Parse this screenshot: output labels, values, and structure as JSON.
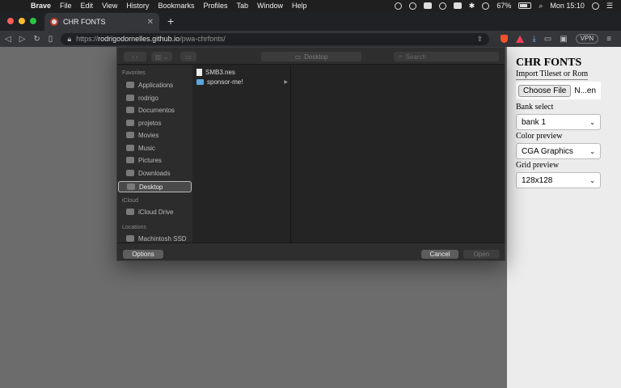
{
  "menubar": {
    "app": "Brave",
    "items": [
      "File",
      "Edit",
      "View",
      "History",
      "Bookmarks",
      "Profiles",
      "Tab",
      "Window",
      "Help"
    ],
    "battery": "67%",
    "clock": "Mon 15:10"
  },
  "tab": {
    "title": "CHR FONTS",
    "close": "✕"
  },
  "toolbar": {
    "url_proto": "https://",
    "url_host": "rodrigodornelles.github.io",
    "url_path": "/pwa-chrfonts/",
    "vpn": "VPN"
  },
  "dialog": {
    "location": "Desktop",
    "search_placeholder": "Search",
    "sidebar": {
      "favorites_header": "Favorites",
      "favorites": [
        {
          "label": "Applications",
          "icon": "applications-icon"
        },
        {
          "label": "rodrigo",
          "icon": "home-icon"
        },
        {
          "label": "Documentos",
          "icon": "document-icon"
        },
        {
          "label": "projetos",
          "icon": "folder-icon"
        },
        {
          "label": "Movies",
          "icon": "film-icon"
        },
        {
          "label": "Music",
          "icon": "music-icon"
        },
        {
          "label": "Pictures",
          "icon": "picture-icon"
        },
        {
          "label": "Downloads",
          "icon": "download-icon"
        },
        {
          "label": "Desktop",
          "icon": "desktop-icon"
        }
      ],
      "icloud_header": "iCloud",
      "icloud": [
        {
          "label": "iCloud Drive",
          "icon": "cloud-icon"
        }
      ],
      "locations_header": "Locations",
      "locations": [
        {
          "label": "Machintosh SSD",
          "icon": "disk-icon"
        }
      ]
    },
    "files": [
      {
        "name": "SMB3.nes",
        "type": "file"
      },
      {
        "name": "sponsor-me!",
        "type": "folder"
      }
    ],
    "options_label": "Options",
    "cancel_label": "Cancel",
    "open_label": "Open"
  },
  "app": {
    "title": "CHR FONTS",
    "import_label": "Import Tileset or Rom",
    "choose_file": "Choose File",
    "file_status": "N...en",
    "bank_label": "Bank select",
    "bank_value": "bank 1",
    "color_label": "Color preview",
    "color_value": "CGA Graphics",
    "grid_label": "Grid preview",
    "grid_value": "128x128"
  }
}
